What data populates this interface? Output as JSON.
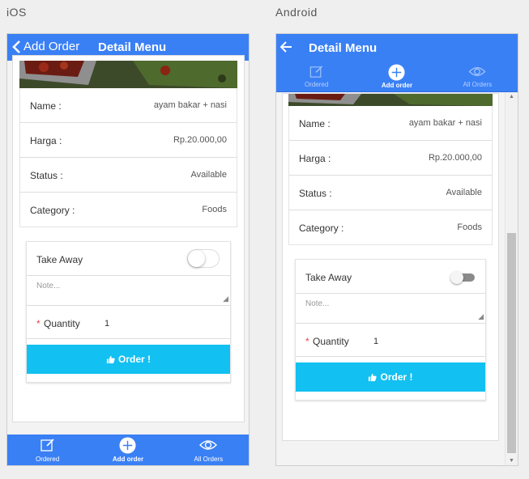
{
  "labels": {
    "ios": "iOS",
    "android": "Android"
  },
  "colors": {
    "primary": "#3a80f5",
    "order_button": "#12c0f1",
    "required": "#ee4444"
  },
  "ios": {
    "back_label": "Add Order",
    "title": "Detail Menu",
    "tabs": [
      {
        "label": "Ordered",
        "icon": "edit-icon"
      },
      {
        "label": "Add order",
        "icon": "add-circle-icon"
      },
      {
        "label": "All Orders",
        "icon": "eye-icon"
      }
    ]
  },
  "android": {
    "title": "Detail Menu",
    "tabs": [
      {
        "label": "Ordered",
        "icon": "edit-icon"
      },
      {
        "label": "Add order",
        "icon": "add-circle-icon"
      },
      {
        "label": "All Orders",
        "icon": "eye-icon"
      }
    ]
  },
  "detail": {
    "name_label": "Name :",
    "name_value": "ayam bakar + nasi",
    "price_label": "Harga :",
    "price_value": "Rp.20.000,00",
    "status_label": "Status :",
    "status_value": "Available",
    "category_label": "Category :",
    "category_value": "Foods"
  },
  "order_form": {
    "take_away_label": "Take Away",
    "take_away_on": false,
    "note_placeholder": "Note...",
    "required_mark": "*",
    "quantity_label": "Quantity",
    "quantity_value": "1",
    "order_button_label": "Order !"
  }
}
